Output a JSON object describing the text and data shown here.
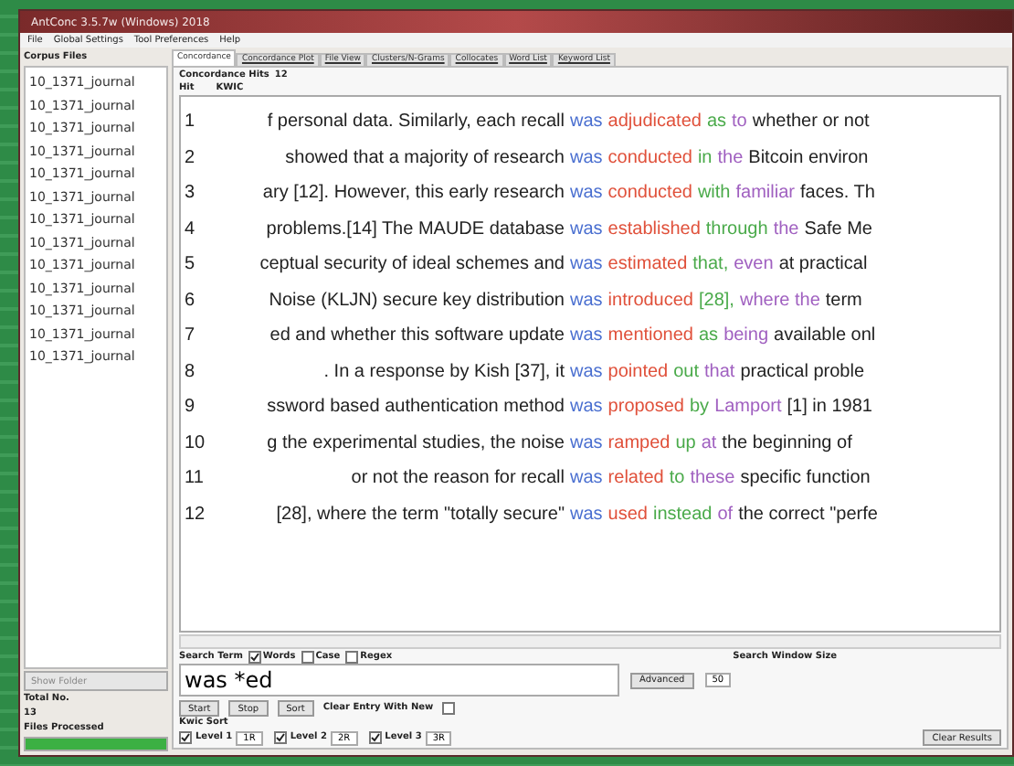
{
  "window": {
    "title": "AntConc 3.5.7w (Windows) 2018"
  },
  "menu": [
    "File",
    "Global Settings",
    "Tool Preferences",
    "Help"
  ],
  "sidebar": {
    "title": "Corpus Files",
    "files": [
      "10_1371_journal",
      "10_1371_journal",
      "10_1371_journal",
      "10_1371_journal",
      "10_1371_journal",
      "10_1371_journal",
      "10_1371_journal",
      "10_1371_journal",
      "10_1371_journal",
      "10_1371_journal",
      "10_1371_journal",
      "10_1371_journal",
      "10_1371_journal"
    ],
    "dropdown": "Show Folder",
    "total_label": "Total No.",
    "total": "13",
    "processed_label": "Files Processed",
    "progress": {
      "level": 1
    }
  },
  "tabs": [
    {
      "label": "Concordance",
      "selected": true
    },
    {
      "label": "Concordance Plot",
      "selected": false
    },
    {
      "label": "File View",
      "selected": false
    },
    {
      "label": "Clusters/N-Grams",
      "selected": false
    },
    {
      "label": "Collocates",
      "selected": false
    },
    {
      "label": "Word List",
      "selected": false
    },
    {
      "label": "Keyword List",
      "selected": false
    }
  ],
  "hits": {
    "label": "Concordance Hits",
    "count": "12"
  },
  "columns": [
    "Hit",
    "KWIC"
  ],
  "lines": [
    {
      "n": "1",
      "left": "f personal data. Similarly, each recall",
      "hit": "was",
      "r1": "adjudicated",
      "r2": "as",
      "r3": "to",
      "rest": "whether or not"
    },
    {
      "n": "2",
      "left": "showed that a majority of research",
      "hit": "was",
      "r1": "conducted",
      "r2": "in",
      "r3": "the",
      "rest": "Bitcoin environ"
    },
    {
      "n": "3",
      "left": "ary [12]. However, this early research",
      "hit": "was",
      "r1": "conducted",
      "r2": "with",
      "r3": "familiar",
      "rest": "faces. Th"
    },
    {
      "n": "4",
      "left": "problems.[14] The MAUDE database",
      "hit": "was",
      "r1": "established",
      "r2": "through",
      "r3": "the",
      "rest": "Safe Me"
    },
    {
      "n": "5",
      "left": "ceptual security of ideal schemes and",
      "hit": "was",
      "r1": "estimated",
      "r2": "that,",
      "r3": "even",
      "rest": "at practical"
    },
    {
      "n": "6",
      "left": "Noise (KLJN) secure key distribution",
      "hit": "was",
      "r1": "introduced",
      "r2": "[28],",
      "r3": "where the",
      "rest": "term"
    },
    {
      "n": "7",
      "left": "ed and whether this software update",
      "hit": "was",
      "r1": "mentioned",
      "r2": "as",
      "r3": "being",
      "rest": "available onl"
    },
    {
      "n": "8",
      "left": ". In a response by Kish [37], it",
      "hit": "was",
      "r1": "pointed",
      "r2": "out",
      "r3": "that",
      "rest": "practical proble"
    },
    {
      "n": "9",
      "left": "ssword based authentication method",
      "hit": "was",
      "r1": "proposed",
      "r2": "by",
      "r3": "Lamport",
      "rest": "[1] in 1981"
    },
    {
      "n": "10",
      "left": "g the experimental studies, the noise",
      "hit": "was",
      "r1": "ramped",
      "r2": "up",
      "r3": "at",
      "rest": "the beginning of"
    },
    {
      "n": "11",
      "left": "or not the reason for recall",
      "hit": "was",
      "r1": "related",
      "r2": "to",
      "r3": "these",
      "rest": "specific function"
    },
    {
      "n": "12",
      "left": "[28], where the term \"totally secure\"",
      "hit": "was",
      "r1": "used",
      "r2": "instead",
      "r3": "of",
      "rest": "the correct \"perfe"
    }
  ],
  "search": {
    "label": "Search Term",
    "options": [
      {
        "label": "Words",
        "checked": true
      },
      {
        "label": "Case",
        "checked": false
      },
      {
        "label": "Regex",
        "checked": false
      }
    ],
    "value": "was *ed",
    "advanced": "Advanced",
    "window_label": "Search Window Size",
    "window_size": "50"
  },
  "buttons": [
    "Start",
    "Stop",
    "Sort"
  ],
  "clear_entry": {
    "label": "Clear Entry With New",
    "checked": false
  },
  "kwic_sort": {
    "label": "Kwic Sort",
    "levels": [
      {
        "label": "Level 1",
        "value": "1R",
        "checked": true
      },
      {
        "label": "Level 2",
        "value": "2R",
        "checked": true
      },
      {
        "label": "Level 3",
        "value": "3R",
        "checked": true
      }
    ]
  },
  "clear_results": "Clear Results"
}
